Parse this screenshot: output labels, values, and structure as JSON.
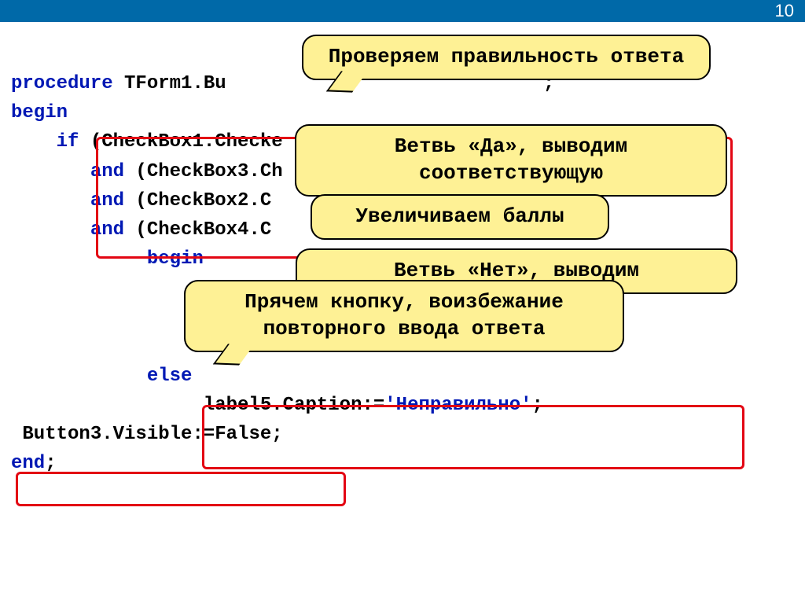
{
  "page_number": "10",
  "code": {
    "l1a": "procedure",
    "l1b": " TForm1.Bu                            ;",
    "l2": "begin",
    "l3a": "    if",
    "l3b": " (CheckBox1.Checke",
    "l4a": "       and",
    "l4b": " (CheckBox3.Ch",
    "l5a": "       and",
    "l5b": " (CheckBox2.C",
    "l6a": "       and",
    "l6b": " (CheckBox4.C",
    "l7": "            begin",
    "l8": " ",
    "l9": " ",
    "l10": " ",
    "l11": "            else",
    "l12a": "                 label5.Caption:=",
    "l12b": "'Неправильно'",
    "l12c": ";",
    "l13": " Button3.Visible:=False;",
    "l14": "end",
    "l14b": ";"
  },
  "callouts": {
    "c1": "Проверяем правильность ответа",
    "c2": "Ветвь «Да», выводим соответствующую",
    "c3": "Увеличиваем баллы",
    "c4": "Ветвь «Нет», выводим",
    "c5": "Прячем кнопку, воизбежание повторного ввода ответа"
  }
}
